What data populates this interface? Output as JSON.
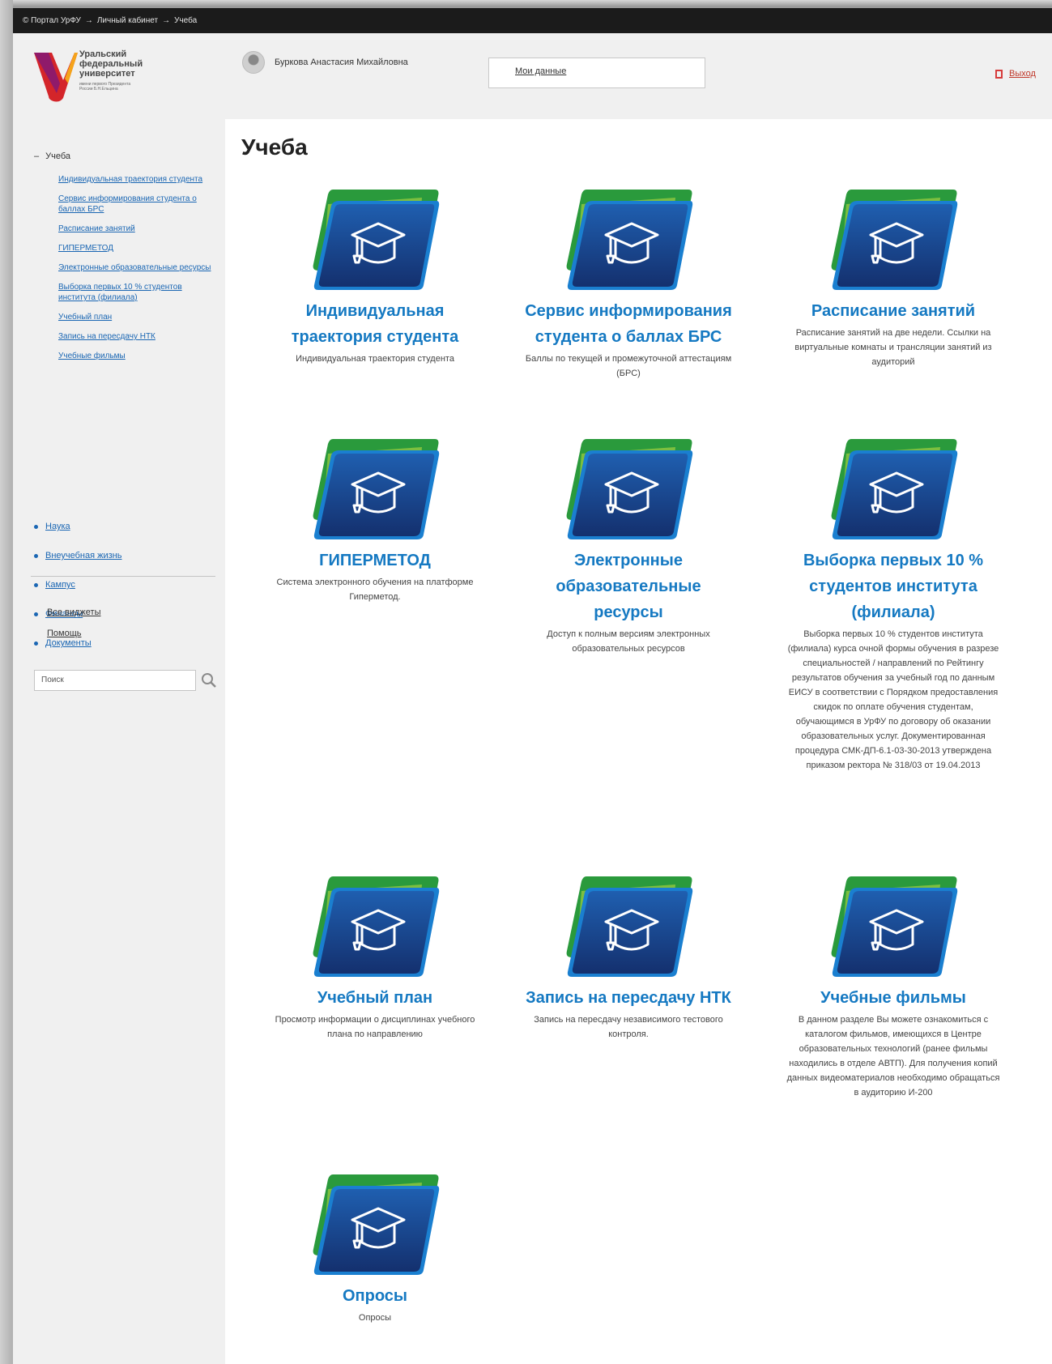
{
  "breadcrumb": [
    "© Портал УрФУ",
    "→",
    "Личный кабинет",
    "→",
    "Учеба"
  ],
  "university": {
    "name": "Уральский федеральный университет",
    "subtitle": "имени первого Президента России Б.Н.Ельцина"
  },
  "user": {
    "name": "Буркова Анастасия Михайловна"
  },
  "my_data_label": "Мои данные",
  "logout_label": "Выход",
  "sidebar": {
    "current": "Учеба",
    "subitems": [
      "Индивидуальная траектория студента",
      "Сервис информирования студента о баллах БРС",
      "Расписание занятий",
      "ГИПЕРМЕТОД",
      "Электронные образовательные ресурсы",
      "Выборка первых 10 % студентов института (филиала)",
      "Учебный план",
      "Запись на пересдачу НТК",
      "Учебные фильмы"
    ],
    "sections": [
      "Наука",
      "Внеучебная жизнь",
      "Кампус",
      "Финансы",
      "Документы"
    ],
    "links": [
      "Все виджеты",
      "Помощь"
    ],
    "search_placeholder": "Поиск"
  },
  "page_title": "Учеба",
  "colors": {
    "accent": "#1579c2",
    "header_bar": "#1b1b1b",
    "logout": "#d63b3b"
  },
  "tiles": [
    {
      "icon": "graduation-cap-icon",
      "title": "Индивидуальная траектория студента",
      "desc": "Индивидуальная траектория студента"
    },
    {
      "icon": "graduation-cap-icon",
      "title": "Сервис информирования студента о баллах БРС",
      "desc": "Баллы по текущей и промежуточной аттестациям (БРС)"
    },
    {
      "icon": "graduation-cap-icon",
      "title": "Расписание занятий",
      "desc": "Расписание занятий на две недели. Ссылки на виртуальные комнаты и трансляции занятий из аудиторий"
    },
    {
      "icon": "graduation-cap-icon",
      "title": "ГИПЕРМЕТОД",
      "desc": "Система электронного обучения на платформе Гиперметод."
    },
    {
      "icon": "graduation-cap-icon",
      "title": "Электронные образовательные ресурсы",
      "desc": "Доступ к полным версиям электронных образовательных ресурсов"
    },
    {
      "icon": "graduation-cap-icon",
      "title": "Выборка первых 10 % студентов института (филиала)",
      "desc": "Выборка первых 10 % студентов института (филиала) курса очной формы обучения в разрезе специальностей / направлений по Рейтингу результатов обучения за учебный год по данным ЕИСУ в соответствии с Порядком предоставления скидок по оплате обучения студентам, обучающимся в УрФУ по договору об оказании образовательных услуг. Документированная процедура СМК-ДП-6.1-03-30-2013 утверждена приказом ректора № 318/03 от 19.04.2013"
    },
    {
      "icon": "graduation-cap-icon",
      "title": "Учебный план",
      "desc": "Просмотр информации о дисциплинах учебного плана по направлению"
    },
    {
      "icon": "graduation-cap-icon",
      "title": "Запись на пересдачу НТК",
      "desc": "Запись на пересдачу независимого тестового контроля."
    },
    {
      "icon": "graduation-cap-icon",
      "title": "Учебные фильмы",
      "desc": "В данном разделе Вы можете ознакомиться с каталогом фильмов, имеющихся в Центре образовательных технологий (ранее фильмы находились в отделе АВТП). Для получения копий данных видеоматериалов необходимо обращаться в аудиторию И-200"
    },
    {
      "icon": "graduation-cap-icon",
      "title": "Опросы",
      "desc": "Опросы"
    }
  ]
}
